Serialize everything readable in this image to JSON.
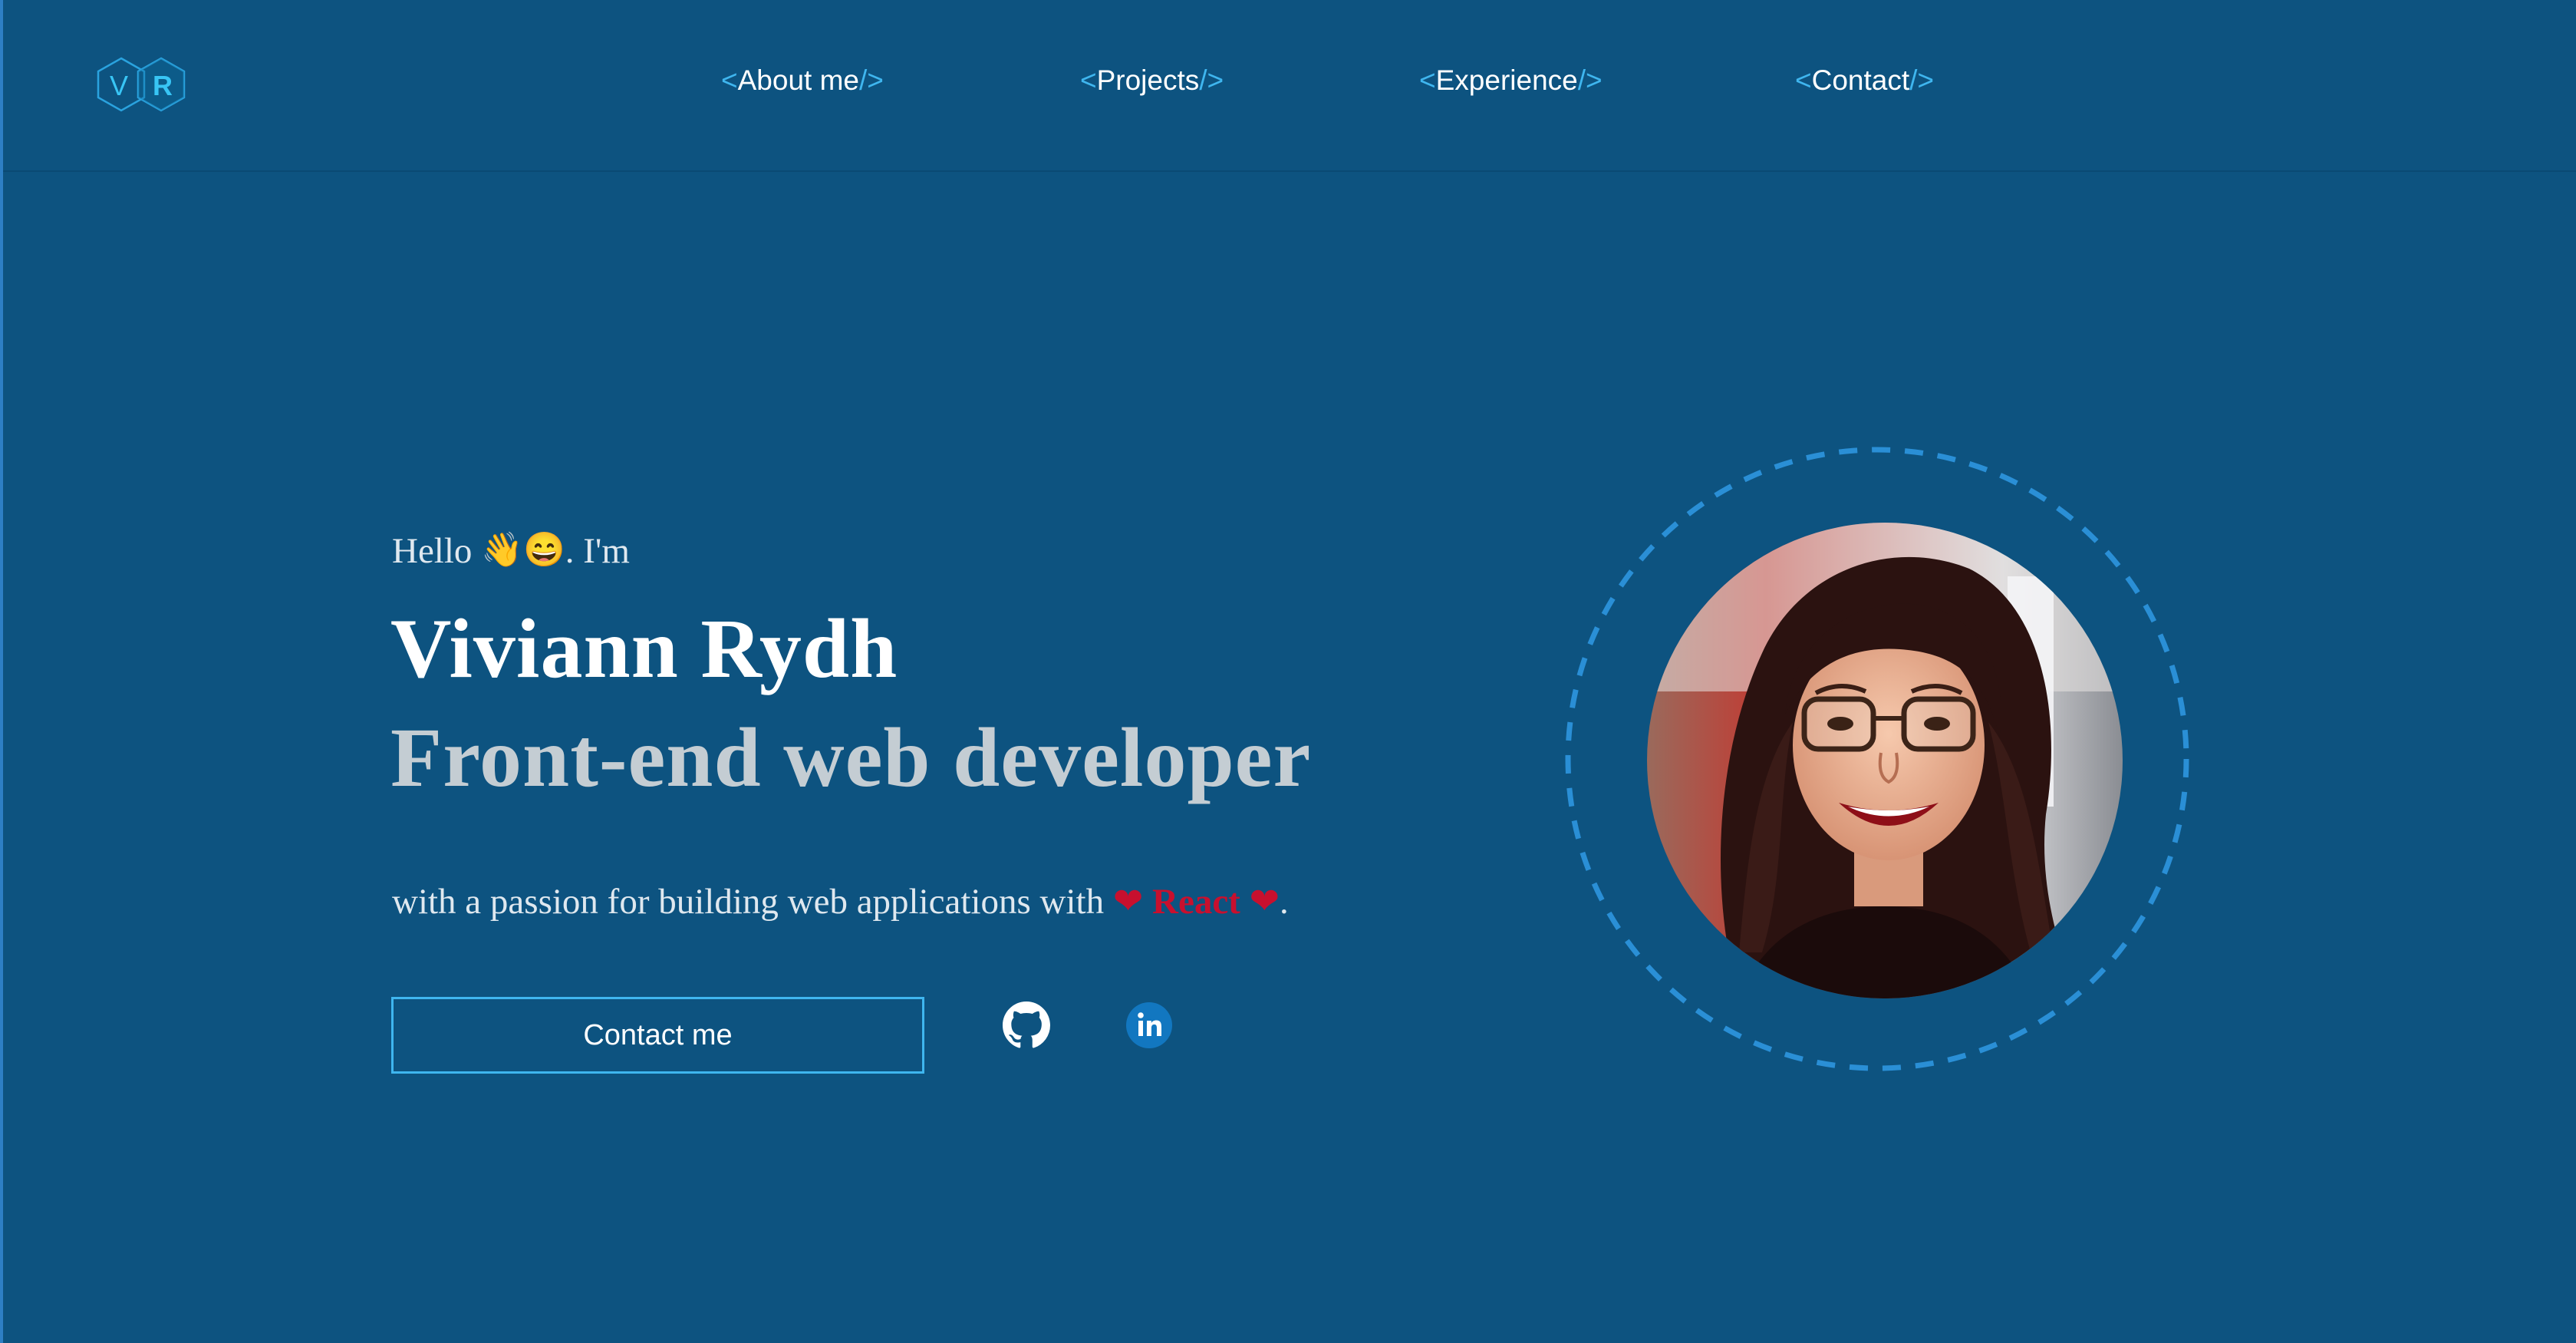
{
  "brand": {
    "logo_letters": [
      "V",
      "R"
    ],
    "accent_color": "#3fb6ef",
    "background_color": "#0d5380"
  },
  "nav": {
    "open_bracket": "<",
    "close_bracket": "/>",
    "items": [
      {
        "label": "About me"
      },
      {
        "label": "Projects"
      },
      {
        "label": "Experience"
      },
      {
        "label": "Contact"
      }
    ]
  },
  "hero": {
    "greeting_prefix": "Hello",
    "greeting_emojis": [
      "👋",
      "😄"
    ],
    "greeting_suffix": ". I'm",
    "name": "Viviann Rydh",
    "role": "Front-end web developer",
    "tagline_prefix": "with a passion for building web applications with",
    "tagline_highlight": "React",
    "heart": "❤",
    "tagline_suffix": ".",
    "contact_button": "Contact me",
    "socials": [
      {
        "icon": "github-icon"
      },
      {
        "icon": "linkedin-icon"
      }
    ]
  },
  "avatar": {
    "icon": "profile-photo",
    "ring_color": "#2a8fd6"
  }
}
